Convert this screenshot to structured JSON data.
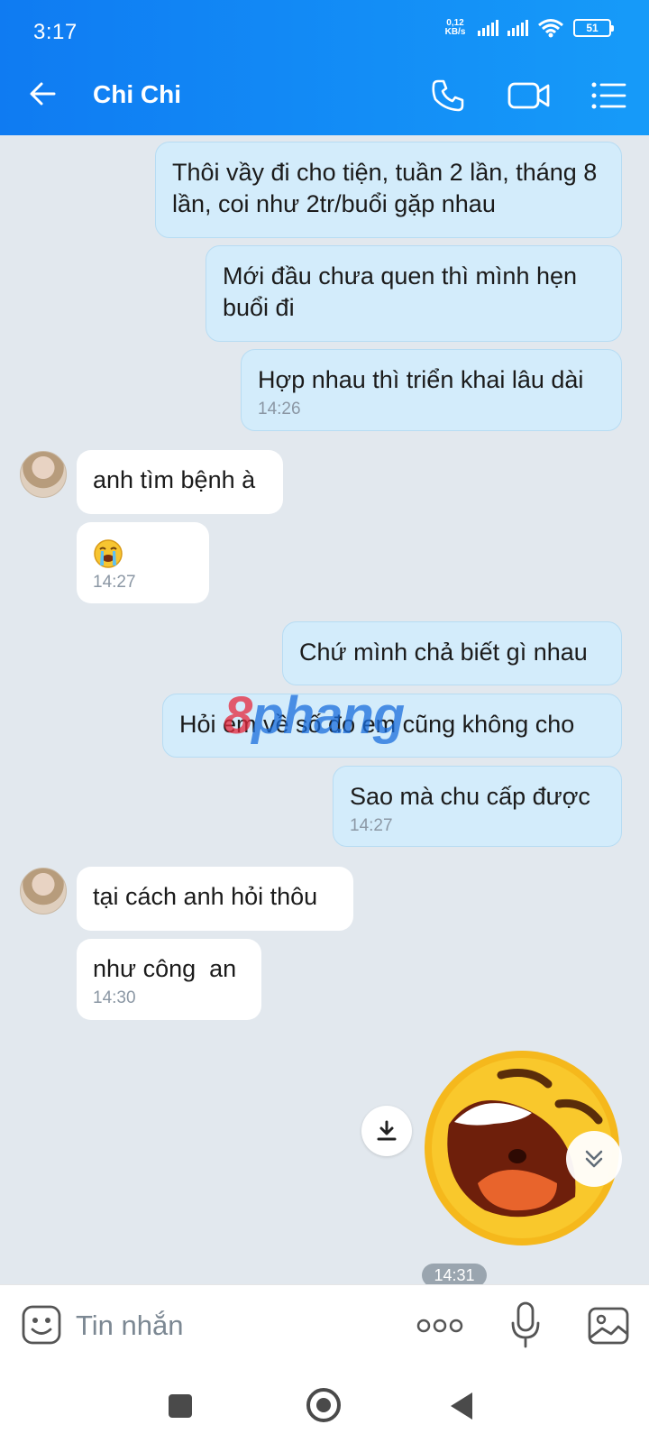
{
  "status_bar": {
    "time": "3:17",
    "net_speed_value": "0,12",
    "net_speed_unit": "KB/s",
    "battery": "51"
  },
  "header": {
    "title": "Chi Chi",
    "icons": [
      "back-arrow-icon",
      "phone-icon",
      "video-call-icon",
      "list-menu-icon"
    ]
  },
  "messages": [
    {
      "side": "out",
      "text": "Thôi vầy đi cho tiện, tuần 2 lần, tháng 8 lần, coi như 2tr/buổi gặp nhau"
    },
    {
      "side": "out",
      "text": "Mới đầu chưa quen thì mình hẹn buổi đi"
    },
    {
      "side": "out",
      "text": "Hợp nhau thì triển khai lâu dài",
      "time": "14:26"
    },
    {
      "side": "in",
      "text": "anh tìm bệnh à"
    },
    {
      "side": "in",
      "emoji": "crying-emoji",
      "time": "14:27"
    },
    {
      "side": "out",
      "text": "Chứ mình chả biết gì nhau"
    },
    {
      "side": "out",
      "text": "Hỏi em về số đo em cũng không cho"
    },
    {
      "side": "out",
      "text": "Sao mà chu cấp được",
      "time": "14:27"
    },
    {
      "side": "in",
      "text": "tại cách anh hỏi thôu"
    },
    {
      "side": "in",
      "text": "như công  an",
      "time": "14:30"
    }
  ],
  "sticker": {
    "name": "laughing-face-sticker",
    "time": "14:31"
  },
  "watermark": {
    "part1": "8",
    "part2": "phang"
  },
  "composer": {
    "placeholder": "Tin nhắn"
  },
  "colors": {
    "header": "#0f7bf2",
    "outgoing_bubble": "#d3ecfb",
    "incoming_bubble": "#ffffff",
    "background": "#e2e8ee"
  }
}
